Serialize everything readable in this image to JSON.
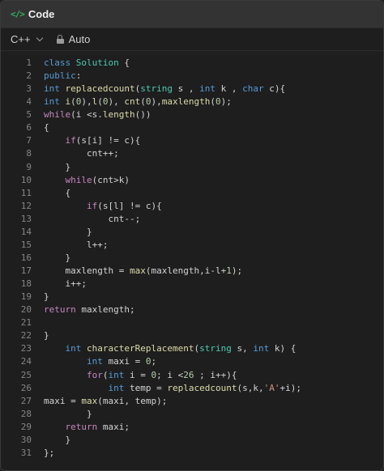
{
  "header": {
    "icon": "code-brackets-icon",
    "title": "Code"
  },
  "toolbar": {
    "language": "C++",
    "mode": "Auto"
  },
  "colors": {
    "accent_green": "#2db55d",
    "keyword": "#569cd6",
    "type": "#4ec9b0",
    "function": "#dcdcaa",
    "number": "#b5cea8",
    "string": "#ce9178",
    "control": "#c586c0",
    "variable": "#9cdcfe"
  },
  "lines": [
    {
      "n": "1",
      "code": "class Solution {"
    },
    {
      "n": "2",
      "code": "public:"
    },
    {
      "n": "3",
      "code": "int replacedcount(string s , int k , char c){"
    },
    {
      "n": "4",
      "code": "int i(0),l(0), cnt(0),maxlength(0);"
    },
    {
      "n": "5",
      "code": "while(i <s.length())"
    },
    {
      "n": "6",
      "code": "{"
    },
    {
      "n": "7",
      "code": "    if(s[i] != c){"
    },
    {
      "n": "8",
      "code": "        cnt++;"
    },
    {
      "n": "9",
      "code": "    }"
    },
    {
      "n": "10",
      "code": "    while(cnt>k)"
    },
    {
      "n": "11",
      "code": "    {"
    },
    {
      "n": "12",
      "code": "        if(s[l] != c){"
    },
    {
      "n": "13",
      "code": "            cnt--;"
    },
    {
      "n": "14",
      "code": "        }"
    },
    {
      "n": "15",
      "code": "        l++;"
    },
    {
      "n": "16",
      "code": "    }"
    },
    {
      "n": "17",
      "code": "    maxlength = max(maxlength,i-l+1);"
    },
    {
      "n": "18",
      "code": "    i++;"
    },
    {
      "n": "19",
      "code": "}"
    },
    {
      "n": "20",
      "code": "return maxlength;"
    },
    {
      "n": "21",
      "code": ""
    },
    {
      "n": "22",
      "code": "}"
    },
    {
      "n": "23",
      "code": "    int characterReplacement(string s, int k) {"
    },
    {
      "n": "24",
      "code": "        int maxi = 0;"
    },
    {
      "n": "25",
      "code": "        for(int i = 0; i <26 ; i++){"
    },
    {
      "n": "26",
      "code": "            int temp = replacedcount(s,k,'A'+i);"
    },
    {
      "n": "27",
      "code": "maxi = max(maxi, temp);"
    },
    {
      "n": "28",
      "code": "        }"
    },
    {
      "n": "29",
      "code": "    return maxi;"
    },
    {
      "n": "30",
      "code": "    }"
    },
    {
      "n": "31",
      "code": "};"
    }
  ]
}
